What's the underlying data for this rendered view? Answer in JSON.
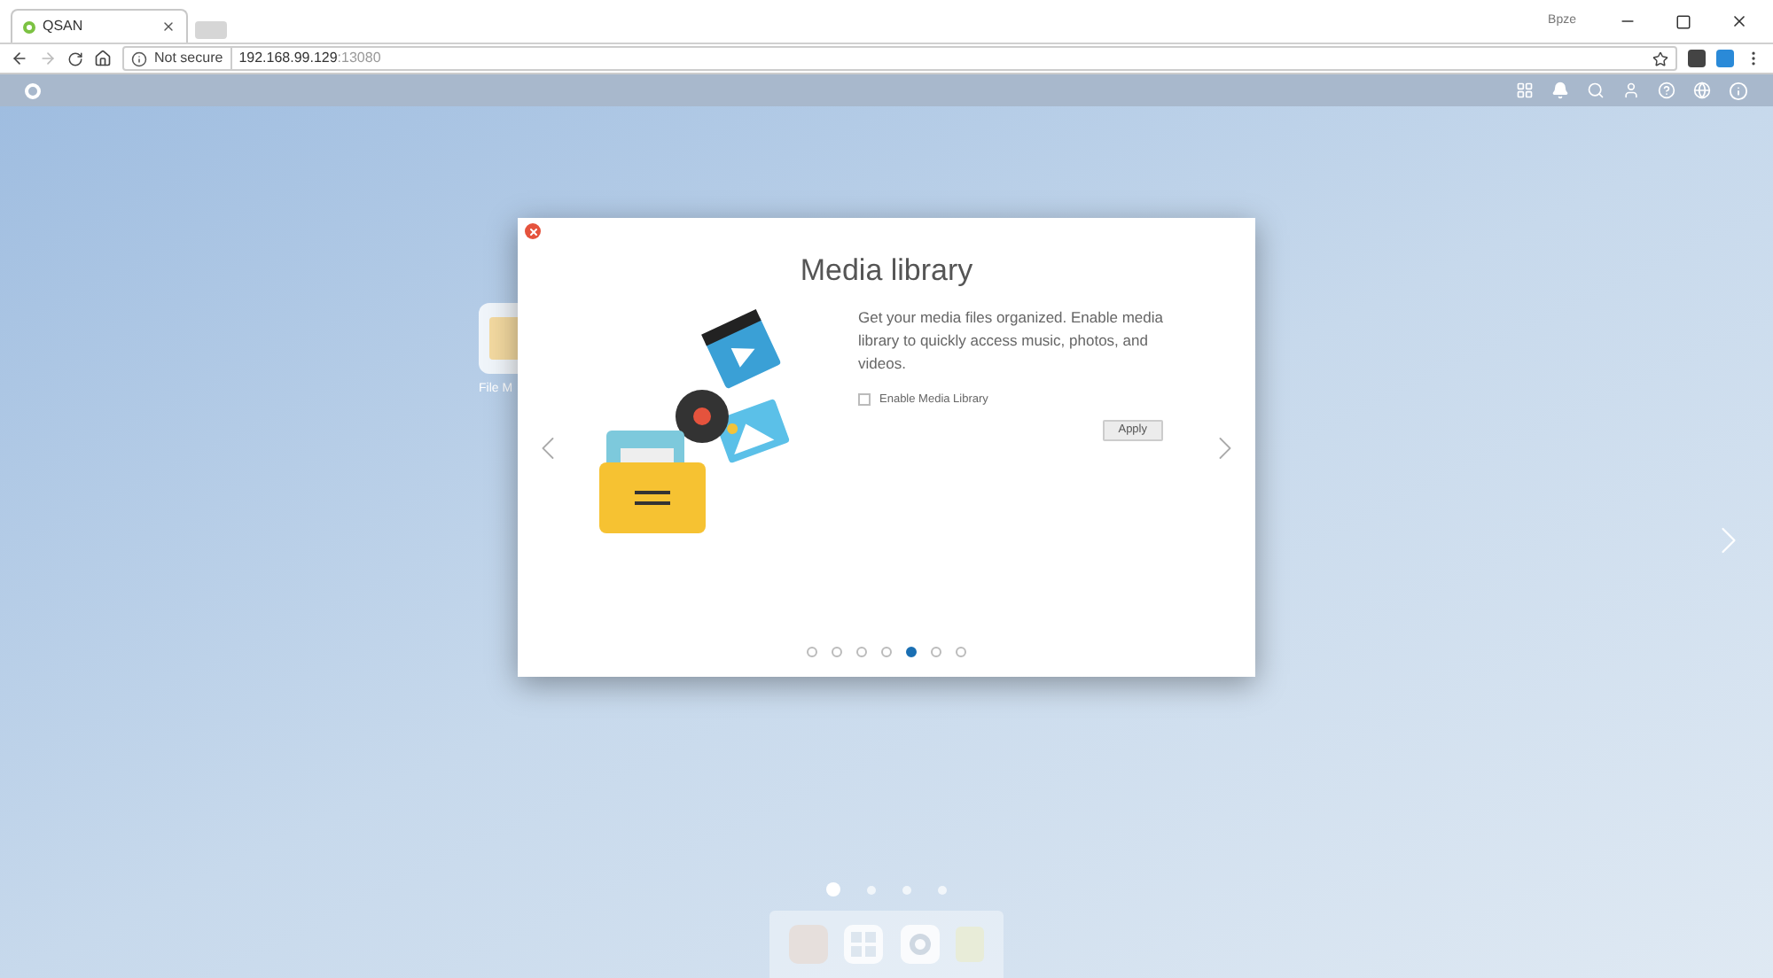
{
  "browser": {
    "profile": "Bpze",
    "tabs": [
      {
        "title": "QSAN",
        "selected": true
      }
    ],
    "address": {
      "security": "Not secure",
      "host": "192.168.99.129",
      "port": ":13080"
    }
  },
  "desktop": {
    "icons": [
      {
        "label": "File M"
      }
    ],
    "pages": [
      {
        "selected": true
      },
      {
        "selected": false
      },
      {
        "selected": false
      },
      {
        "selected": false
      }
    ]
  },
  "dialog": {
    "title": "Media library",
    "description": "Get your media files organized. Enable media library to quickly access music, photos, and videos.",
    "checkbox": {
      "label": "Enable Media Library",
      "checked": false
    },
    "button": "Apply",
    "steps": [
      {
        "selected": false
      },
      {
        "selected": false
      },
      {
        "selected": false
      },
      {
        "selected": false
      },
      {
        "selected": true
      },
      {
        "selected": false
      },
      {
        "selected": false
      }
    ]
  }
}
